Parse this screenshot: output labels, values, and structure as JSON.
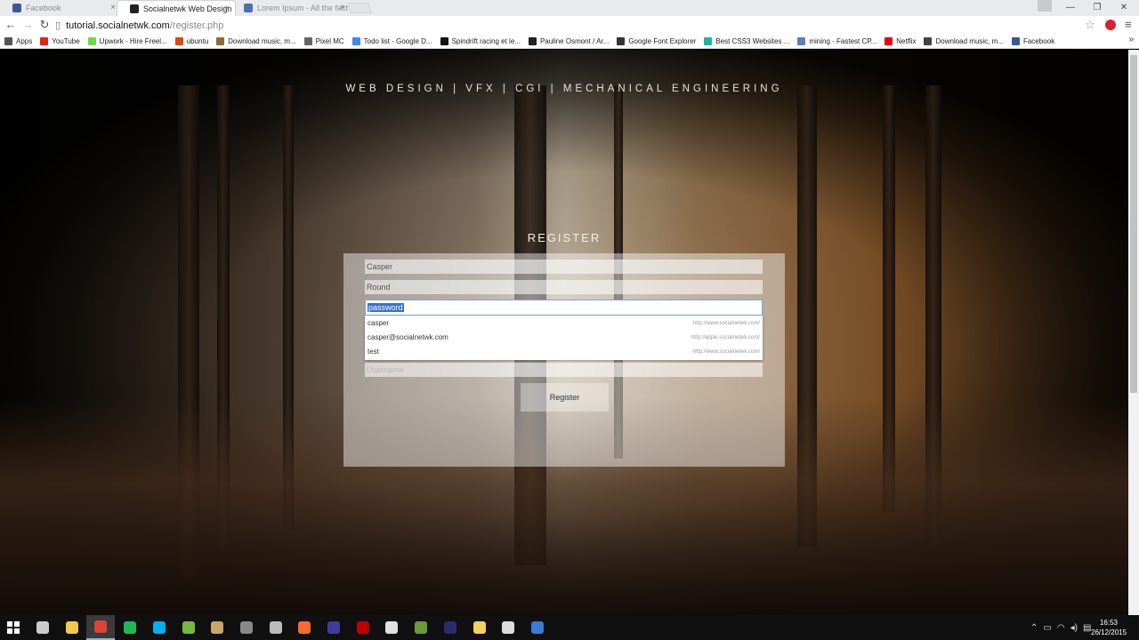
{
  "tabs": [
    {
      "label": "Facebook",
      "color": "#3b5998"
    },
    {
      "label": "Socialnetwk Web Design",
      "color": "#222222"
    },
    {
      "label": "Lorem Ipsum - All the fact",
      "color": "#4a6fb5"
    }
  ],
  "tab_close": "×",
  "window": {
    "minimize": "—",
    "maximize": "❐",
    "close": "✕"
  },
  "nav": {
    "back": "←",
    "forward": "→",
    "reload": "↻"
  },
  "address": {
    "host": "tutorial.socialnetwk.com",
    "path": "/register.php"
  },
  "bookmarks": [
    {
      "label": "Apps",
      "color": "#555555"
    },
    {
      "label": "YouTube",
      "color": "#e62117"
    },
    {
      "label": "Upwork - Hire Freel...",
      "color": "#6fda44"
    },
    {
      "label": "ubuntu",
      "color": "#dd4814"
    },
    {
      "label": "Download music, m...",
      "color": "#8a6d3b"
    },
    {
      "label": "Pixel MC",
      "color": "#666666"
    },
    {
      "label": "Todo list - Google D...",
      "color": "#4285f4"
    },
    {
      "label": "Spindrift racing et le...",
      "color": "#111111"
    },
    {
      "label": "Pauline Osmont / Ar...",
      "color": "#222222"
    },
    {
      "label": "Google Font Explorer",
      "color": "#333333"
    },
    {
      "label": "Best CSS3 Websites ...",
      "color": "#20b2aa"
    },
    {
      "label": "mining - Fastest CP...",
      "color": "#5b7ec9"
    },
    {
      "label": "Netflix",
      "color": "#e50914"
    },
    {
      "label": "Download music, m...",
      "color": "#444444"
    },
    {
      "label": "Facebook",
      "color": "#3b5998"
    }
  ],
  "bookmarks_more": "»",
  "page": {
    "tagline": "WEB DESIGN | VFX | CGI | MECHANICAL ENGINEERING",
    "register_title": "REGISTER",
    "fields": {
      "first_name": "Casper",
      "last_name": "Round",
      "password": "password",
      "username_placeholder": "Username"
    },
    "autocomplete": [
      {
        "value": "casper",
        "source": "http://www.socialnetwk.com/"
      },
      {
        "value": "casper@socialnetwk.com",
        "source": "http://apple.socialnetwk.com/"
      },
      {
        "value": "test",
        "source": "http://www.socialnetwk.com/"
      }
    ],
    "register_button": "Register"
  },
  "taskbar": {
    "apps": [
      {
        "name": "task-view",
        "color": "#cccccc"
      },
      {
        "name": "file-explorer",
        "color": "#f2c94c"
      },
      {
        "name": "chrome",
        "color": "#db4437"
      },
      {
        "name": "spotify",
        "color": "#1db954"
      },
      {
        "name": "skype",
        "color": "#00aff0"
      },
      {
        "name": "utorrent",
        "color": "#76b83f"
      },
      {
        "name": "media-player",
        "color": "#c9a66b"
      },
      {
        "name": "live",
        "color": "#888888"
      },
      {
        "name": "minecraft",
        "color": "#bbbbbb"
      },
      {
        "name": "origin",
        "color": "#f56c2d"
      },
      {
        "name": "obs",
        "color": "#3d3d9e"
      },
      {
        "name": "filezilla",
        "color": "#bf0000"
      },
      {
        "name": "blender",
        "color": "#e0e0e0"
      },
      {
        "name": "unity-block",
        "color": "#6a9a3a"
      },
      {
        "name": "after-effects",
        "color": "#2a2a6e"
      },
      {
        "name": "folder",
        "color": "#f2d15c"
      },
      {
        "name": "unity",
        "color": "#dddddd"
      },
      {
        "name": "visual-studio",
        "color": "#3a7bd5"
      }
    ],
    "tray_up": "⌃",
    "time": "16:53",
    "date": "26/12/2015"
  }
}
